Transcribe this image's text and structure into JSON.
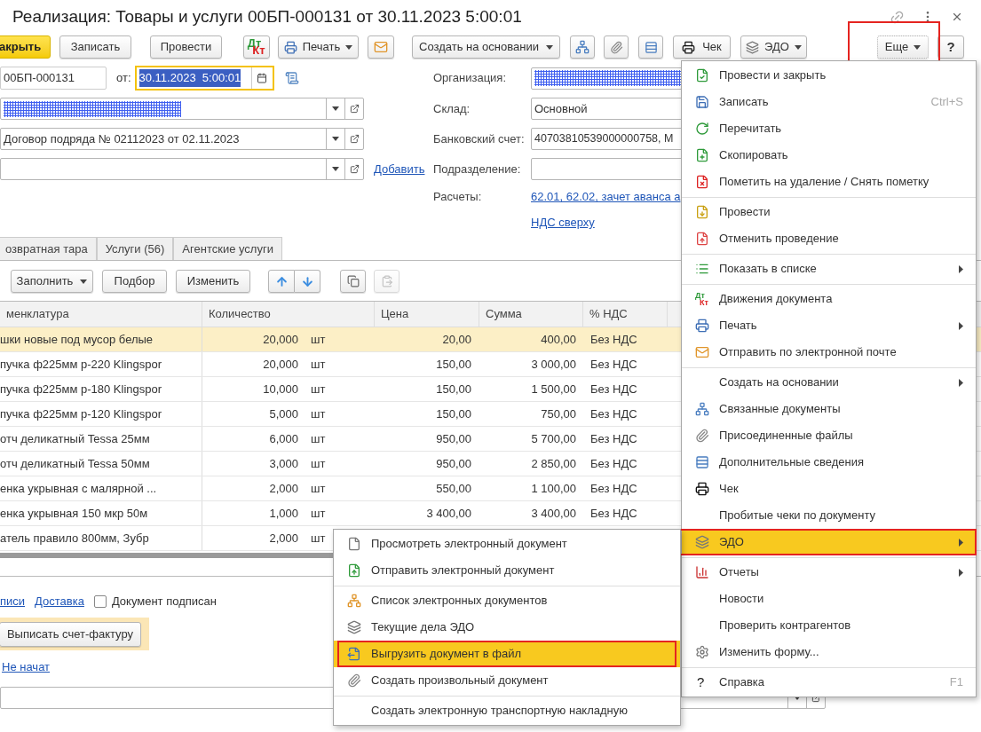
{
  "window": {
    "title": "Реализация: Товары и услуги 00БП-000131 от 30.11.2023 5:00:01"
  },
  "toolbar": {
    "close": {
      "label": "акрыть"
    },
    "save": {
      "label": "Записать"
    },
    "post": {
      "label": "Провести"
    },
    "movements": {
      "top": "Дт",
      "bottom": "Кт"
    },
    "print": {
      "label": "Печать"
    },
    "create_based": {
      "label": "Создать на основании"
    },
    "receipt": {
      "label": "Чек"
    },
    "edo": {
      "label": "ЭДО"
    },
    "more": {
      "label": "Еще",
      "outlined": true
    },
    "help": {
      "label": "?"
    }
  },
  "header": {
    "number": "00БП-000131",
    "date_label": "от:",
    "date": "30.11.2023  5:00:01",
    "counterparty": {
      "redacted": true
    },
    "contract": {
      "value": "Договор подряда № 02112023 от 02.11.2023"
    },
    "add_link": "Добавить",
    "organization": {
      "label": "Организация:",
      "redacted": true
    },
    "warehouse": {
      "label": "Склад:",
      "value": "Основной"
    },
    "bank_account": {
      "label": "Банковский счет:",
      "value": "40703810539000000758, М"
    },
    "division": {
      "label": "Подразделение:"
    },
    "settlements": {
      "label": "Расчеты:",
      "link": "62.01, 62.02, зачет аванса а"
    },
    "vat_link": "НДС сверху"
  },
  "tabs": [
    {
      "label": "озвратная тара",
      "selected": false
    },
    {
      "label": "Услуги (56)",
      "selected": false
    },
    {
      "label": "Агентские услуги",
      "selected": false
    }
  ],
  "table_toolbar": {
    "fill": "Заполнить",
    "pick": "Подбор",
    "edit": "Изменить",
    "paste_disabled": true
  },
  "table": {
    "columns": [
      "менклатура",
      "Количество",
      "Цена",
      "Сумма",
      "% НДС"
    ],
    "rows": [
      {
        "selected": true,
        "name": "шки новые под мусор белые",
        "qty": "20,000",
        "unit": "шт",
        "price": "20,00",
        "sum": "400,00",
        "vat": "Без НДС"
      },
      {
        "selected": false,
        "name": "пучка ф225мм р-220 Klingspor",
        "qty": "20,000",
        "unit": "шт",
        "price": "150,00",
        "sum": "3 000,00",
        "vat": "Без НДС"
      },
      {
        "selected": false,
        "name": "пучка ф225мм р-180 Klingspor",
        "qty": "10,000",
        "unit": "шт",
        "price": "150,00",
        "sum": "1 500,00",
        "vat": "Без НДС"
      },
      {
        "selected": false,
        "name": "пучка ф225мм р-120 Klingspor",
        "qty": "5,000",
        "unit": "шт",
        "price": "150,00",
        "sum": "750,00",
        "vat": "Без НДС"
      },
      {
        "selected": false,
        "name": "отч деликатный Tessa 25мм",
        "qty": "6,000",
        "unit": "шт",
        "price": "950,00",
        "sum": "5 700,00",
        "vat": "Без НДС"
      },
      {
        "selected": false,
        "name": "отч деликатный Tessa 50мм",
        "qty": "3,000",
        "unit": "шт",
        "price": "950,00",
        "sum": "2 850,00",
        "vat": "Без НДС"
      },
      {
        "selected": false,
        "name": "енка укрывная с малярной ...",
        "qty": "2,000",
        "unit": "шт",
        "price": "550,00",
        "sum": "1 100,00",
        "vat": "Без НДС"
      },
      {
        "selected": false,
        "name": "енка укрывная 150 мкр 50м",
        "qty": "1,000",
        "unit": "шт",
        "price": "3 400,00",
        "sum": "3 400,00",
        "vat": "Без НДС"
      },
      {
        "selected": false,
        "name": "атель правило 800мм, Зубр",
        "qty": "2,000",
        "unit": "шт"
      }
    ]
  },
  "footer": {
    "links": [
      "писи",
      "Доставка"
    ],
    "checkbox": {
      "label": "Документ подписан",
      "checked": false
    },
    "invoice_button": "Выписать счет-фактуру",
    "status_link": "Не начат"
  },
  "more_menu": {
    "items": [
      {
        "label": "Провести и закрыть",
        "selected": false
      },
      {
        "label": "Записать",
        "shortcut": "Ctrl+S",
        "selected": false
      },
      {
        "label": "Перечитать",
        "selected": false
      },
      {
        "label": "Скопировать",
        "selected": false
      },
      {
        "label": "Пометить на удаление / Снять пометку",
        "selected": false
      },
      {
        "label": "Провести",
        "selected": false,
        "separator_before": true
      },
      {
        "label": "Отменить проведение",
        "selected": false
      },
      {
        "label": "Показать в списке",
        "submenu": true,
        "selected": false,
        "separator_before": true
      },
      {
        "label": "Движения документа",
        "badge": [
          "Дт",
          "Кт"
        ],
        "selected": false,
        "separator_before": true
      },
      {
        "label": "Печать",
        "submenu": true,
        "selected": false
      },
      {
        "label": "Отправить по электронной почте",
        "selected": false
      },
      {
        "label": "Создать на основании",
        "submenu": true,
        "selected": false,
        "separator_before": true
      },
      {
        "label": "Связанные документы",
        "selected": false
      },
      {
        "label": "Присоединенные файлы",
        "selected": false
      },
      {
        "label": "Дополнительные сведения",
        "selected": false
      },
      {
        "label": "Чек",
        "selected": false
      },
      {
        "label": "Пробитые чеки по документу",
        "selected": false
      },
      {
        "label": "ЭДО",
        "submenu": true,
        "selected": true,
        "outlined": true
      },
      {
        "label": "Отчеты",
        "submenu": true,
        "selected": false,
        "separator_before": true
      },
      {
        "label": "Новости",
        "selected": false
      },
      {
        "label": "Проверить контрагентов",
        "selected": false
      },
      {
        "label": "Изменить форму...",
        "selected": false
      },
      {
        "label": "Справка",
        "glyph": "?",
        "shortcut": "F1",
        "selected": false,
        "separator_before": true
      }
    ]
  },
  "edo_menu": {
    "items": [
      {
        "label": "Просмотреть электронный документ",
        "selected": false
      },
      {
        "label": "Отправить электронный документ",
        "selected": false
      },
      {
        "label": "Список электронных документов",
        "selected": false,
        "separator_before": true
      },
      {
        "label": "Текущие дела ЭДО",
        "selected": false
      },
      {
        "label": "Выгрузить документ в файл",
        "selected": true,
        "outlined": true
      },
      {
        "label": "Создать произвольный документ",
        "selected": false
      },
      {
        "label": "Создать электронную транспортную накладную",
        "selected": false,
        "separator_before": true
      }
    ]
  }
}
